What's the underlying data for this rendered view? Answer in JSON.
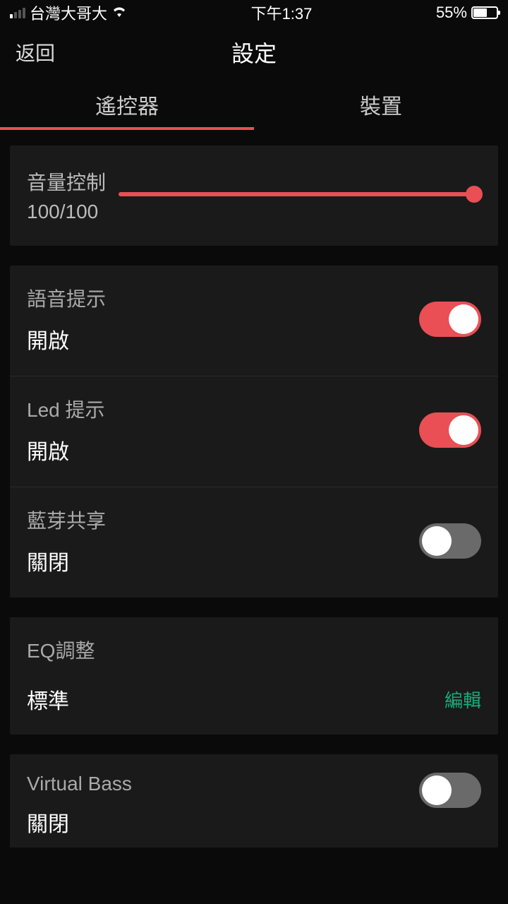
{
  "statusBar": {
    "carrier": "台灣大哥大",
    "time": "下午1:37",
    "batteryPercent": "55%"
  },
  "header": {
    "back": "返回",
    "title": "設定"
  },
  "tabs": {
    "remote": "遙控器",
    "device": "裝置"
  },
  "volume": {
    "label": "音量控制",
    "value": "100/100",
    "percent": 100
  },
  "settings": {
    "voicePrompt": {
      "label": "語音提示",
      "status": "開啟",
      "on": true
    },
    "ledPrompt": {
      "label": "Led 提示",
      "status": "開啟",
      "on": true
    },
    "btShare": {
      "label": "藍芽共享",
      "status": "關閉",
      "on": false
    }
  },
  "eq": {
    "label": "EQ調整",
    "value": "標準",
    "edit": "編輯"
  },
  "virtualBass": {
    "label": "Virtual Bass",
    "status": "關閉",
    "on": false
  },
  "colors": {
    "accent": "#e94f55",
    "edit": "#1aaa7a"
  }
}
